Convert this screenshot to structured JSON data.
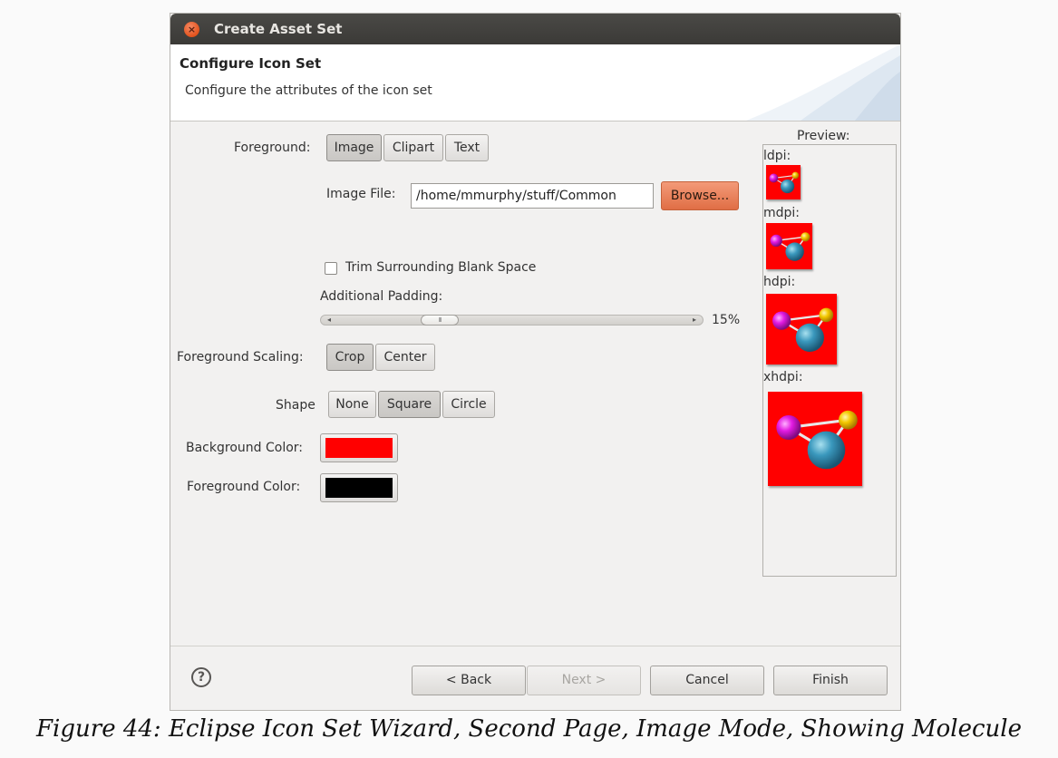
{
  "window": {
    "title": "Create Asset Set",
    "close_glyph": "×"
  },
  "header": {
    "title": "Configure Icon Set",
    "description": "Configure the attributes of the icon set"
  },
  "form": {
    "foreground": {
      "label": "Foreground:",
      "options": [
        "Image",
        "Clipart",
        "Text"
      ],
      "selected": "Image"
    },
    "image_file": {
      "label": "Image File:",
      "value": "/home/mmurphy/stuff/Common",
      "browse_label": "Browse..."
    },
    "trim": {
      "label": "Trim Surrounding Blank Space",
      "checked": false
    },
    "padding": {
      "label": "Additional Padding:",
      "value_text": "15%",
      "left_arrow": "◂",
      "right_arrow": "▸",
      "thumb_grip": "III"
    },
    "scaling": {
      "label": "Foreground Scaling:",
      "options": [
        "Crop",
        "Center"
      ],
      "selected": "Crop"
    },
    "shape": {
      "label": "Shape",
      "options": [
        "None",
        "Square",
        "Circle"
      ],
      "selected": "Square"
    },
    "background_color": {
      "label": "Background Color:",
      "color": "#ff0000"
    },
    "foreground_color": {
      "label": "Foreground Color:",
      "color": "#000000"
    }
  },
  "preview": {
    "title": "Preview:",
    "densities": [
      {
        "label": "ldpi:",
        "icon": "molecule-icon"
      },
      {
        "label": "mdpi:",
        "icon": "molecule-icon"
      },
      {
        "label": "hdpi:",
        "icon": "molecule-icon"
      },
      {
        "label": "xhdpi:",
        "icon": "molecule-icon"
      }
    ]
  },
  "footer": {
    "help_glyph": "?",
    "back_label": "< Back",
    "next_label": "Next >",
    "cancel_label": "Cancel",
    "finish_label": "Finish"
  },
  "caption": "Figure 44: Eclipse Icon Set Wizard, Second Page, Image Mode, Showing Molecule",
  "colors": {
    "titlebar": "#3f3e3b",
    "accent_orange": "#e8774d",
    "icon_background": "#ff0000"
  }
}
